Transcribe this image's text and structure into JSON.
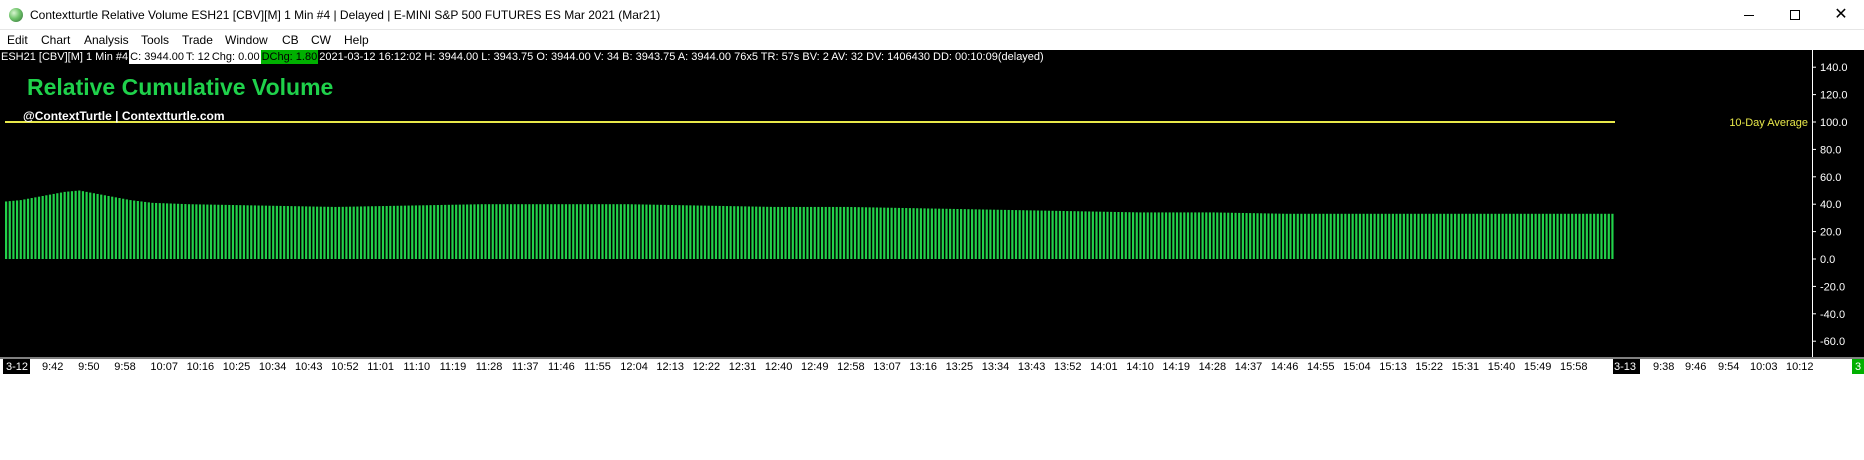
{
  "window": {
    "title": "Contextturtle Relative Volume ESH21 [CBV][M]  1 Min  #4 | Delayed | E-MINI S&P 500 FUTURES ES Mar 2021 (Mar21)"
  },
  "menu": [
    "Edit",
    "Chart",
    "Analysis",
    "Tools",
    "Trade",
    "Window",
    "CB",
    "CW",
    "Help"
  ],
  "statusbar": [
    {
      "text": "ESH21 [CBV][M]  1 Min   #4",
      "style": "plain"
    },
    {
      "text": "C: 3944.00",
      "style": "white"
    },
    {
      "text": "T: 12",
      "style": "white"
    },
    {
      "text": "Chg: 0.00",
      "style": "white"
    },
    {
      "text": "DChg: 1.80",
      "style": "green"
    },
    {
      "text": "2021-03-12 16:12:02  H: 3944.00  L: 3943.75  O: 3944.00  V: 34  B: 3943.75  A: 3944.00  76x5  TR: 57s  BV: 2  AV: 32  DV: 1406430  DD: 00:10:09(delayed)",
      "style": "plain"
    }
  ],
  "colors": {
    "background": "#000000",
    "bars": "#22d14a",
    "reference_line": "#e8e84a",
    "axis_text": "#ffffff",
    "title": "#1fd14b"
  },
  "chart_data": {
    "type": "bar",
    "title": "Relative Cumulative Volume",
    "subtitle": "@ContextTurtle | Contextturtle.com",
    "ylim": [
      -70,
      150
    ],
    "yticks": [
      140,
      120,
      100,
      80,
      60,
      40,
      20,
      0,
      -20,
      -40,
      -60
    ],
    "reference_line": {
      "value": 100,
      "label": "10-Day Average"
    },
    "x_tick_labels": [
      "3-12",
      "9:42",
      "9:50",
      "9:58",
      "10:07",
      "10:16",
      "10:25",
      "10:34",
      "10:43",
      "10:52",
      "11:01",
      "11:10",
      "11:19",
      "11:28",
      "11:37",
      "11:46",
      "11:55",
      "12:04",
      "12:13",
      "12:22",
      "12:31",
      "12:40",
      "12:49",
      "12:58",
      "13:07",
      "13:16",
      "13:25",
      "13:34",
      "13:43",
      "13:52",
      "14:01",
      "14:10",
      "14:19",
      "14:28",
      "14:37",
      "14:46",
      "14:55",
      "15:04",
      "15:13",
      "15:22",
      "15:31",
      "15:40",
      "15:49",
      "15:58",
      "3-13",
      "9:38",
      "9:46",
      "9:54",
      "10:03",
      "10:12"
    ],
    "highlighted_x_labels": [
      "3-12",
      "3-13"
    ],
    "corner_badge": "3",
    "keyframes": [
      [
        0,
        42
      ],
      [
        4,
        43
      ],
      [
        8,
        45
      ],
      [
        12,
        47
      ],
      [
        16,
        49
      ],
      [
        20,
        50
      ],
      [
        22,
        49
      ],
      [
        26,
        47
      ],
      [
        30,
        45
      ],
      [
        34,
        43
      ],
      [
        40,
        41
      ],
      [
        50,
        40
      ],
      [
        70,
        39
      ],
      [
        90,
        38
      ],
      [
        110,
        39
      ],
      [
        130,
        40
      ],
      [
        150,
        40
      ],
      [
        170,
        40
      ],
      [
        190,
        39
      ],
      [
        210,
        38
      ],
      [
        230,
        38
      ],
      [
        250,
        37
      ],
      [
        270,
        36
      ],
      [
        290,
        35
      ],
      [
        310,
        34
      ],
      [
        330,
        34
      ],
      [
        350,
        33
      ],
      [
        370,
        33
      ],
      [
        400,
        33
      ],
      [
        440,
        33
      ]
    ],
    "bar_count": 440
  }
}
